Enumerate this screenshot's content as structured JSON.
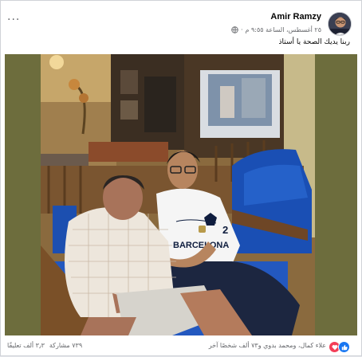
{
  "post": {
    "author": "Amir Ramzy",
    "date": "٢٥ أغسطس، الساعة ٩:٥٥ م",
    "separator": "·",
    "caption": "ربنا يديك الصحة يا أستاذ",
    "more_label": "···",
    "privacy_icon": "globe-icon",
    "photo_alt": "Photo of two men sitting on a blue sofa in a living room",
    "jersey_text": "BARCELONA"
  },
  "footer": {
    "reactions_summary": "علاء كمال، ومحمد بدوي و٧٣ ألف شخصًا آخر",
    "comments": "٣٫٣ ألف تعليقًا",
    "shares": "٧٣٩ مشاركة"
  },
  "colors": {
    "accent": "#1877f2",
    "love": "#f33e58",
    "meta": "#65676b"
  }
}
